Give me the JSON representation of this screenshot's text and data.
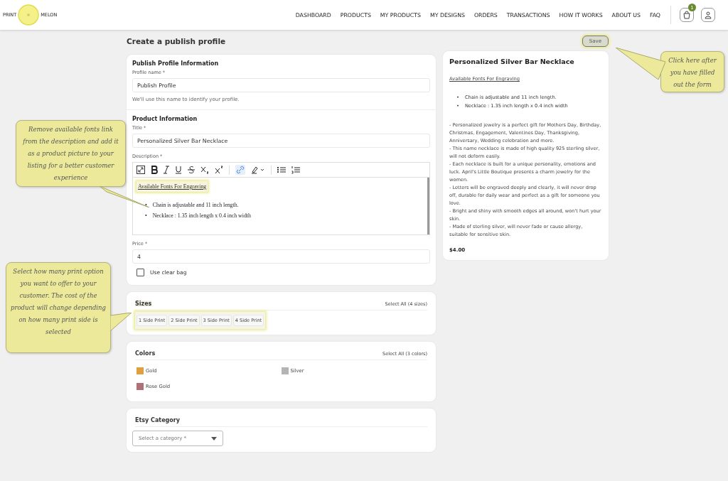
{
  "logo": {
    "left": "PRINT",
    "right": "MELON"
  },
  "nav": [
    {
      "label": "DASHBOARD"
    },
    {
      "label": "PRODUCTS"
    },
    {
      "label": "MY PRODUCTS"
    },
    {
      "label": "MY DESIGNS"
    },
    {
      "label": "ORDERS"
    },
    {
      "label": "TRANSACTIONS"
    },
    {
      "label": "HOW IT WORKS"
    },
    {
      "label": "ABOUT US"
    },
    {
      "label": "FAQ"
    }
  ],
  "cart_badge": "1",
  "page_title": "Create a publish profile",
  "save_button": {
    "label": "Save",
    "disabled": true
  },
  "profile": {
    "heading": "Publish Profile Information",
    "name_label": "Profile name *",
    "name_value": "Publish Profile",
    "hint": "We'll use this name to identify your profile."
  },
  "product": {
    "heading": "Product Information",
    "title_label": "Title *",
    "title_value": "Personalized Silver Bar Necklace",
    "description_label": "Description *",
    "description": {
      "link": "Available Fonts For Engraving",
      "marker": "•",
      "bullets": [
        "Chain is adjustable and 11 inch length.",
        "Necklace : 1.35 inch length x 0.4 inch width"
      ]
    },
    "price_label": "Price *",
    "price_value": "4",
    "clear_bag": {
      "label": "Use clear bag",
      "checked": false
    }
  },
  "sizes": {
    "heading": "Sizes",
    "select_all": "Select All (4 sizes)",
    "options": [
      {
        "label": "1 Side Print"
      },
      {
        "label": "2 Side Print"
      },
      {
        "label": "3 Side Print"
      },
      {
        "label": "4 Side Print"
      }
    ]
  },
  "colors": {
    "heading": "Colors",
    "select_all": "Select All (3 colors)",
    "options": [
      {
        "label": "Gold",
        "color": "#e0a040"
      },
      {
        "label": "Silver",
        "color": "#b4b4b4"
      },
      {
        "label": "Rose Gold",
        "color": "#b07078"
      }
    ]
  },
  "etsy": {
    "heading": "Etsy Category",
    "placeholder": "Select a category *"
  },
  "preview": {
    "title": "Personalized Silver Bar Necklace",
    "link": "Available Fonts For Engraving",
    "marker": "•",
    "bullets": [
      "Chain is adjustable and 11 inch length.",
      "Necklace : 1.35 inch length x 0.4 inch width"
    ],
    "paragraphs": [
      "- Personalized jewelry is a perfect gift for Mothers Day, Birthday, Christmas, Engagement, Valentines Day, Thanksgiving, Anniversary, Wedding celebration and more.",
      "- This name necklace is made of high quality 925 sterling silver, will not deform easily.",
      "- Each necklace is built for a unique personality, emotions and luck. April's Little Boutique presents a charm jewelry for the women.",
      "- Letters will be engraved deeply and clearly, it will never drop off, durable for daily wear and perfect as a gift for someone you love.",
      "- Bright and shiny with smooth edges all around, won't hurt your skin.",
      "- Made of sterling silver, will never fade or cause allergy, suitable for sensitive skin."
    ],
    "price": "$4.00"
  },
  "callouts": [
    {
      "text": "Remove available fonts link from the description and add it as a product picture to your listing for a better customer experience"
    },
    {
      "text": "Select how many print option you want to offer to your customer. The cost of the product will change depending on how many print side is selected"
    },
    {
      "text": "Click here after you have filled out the form"
    }
  ]
}
